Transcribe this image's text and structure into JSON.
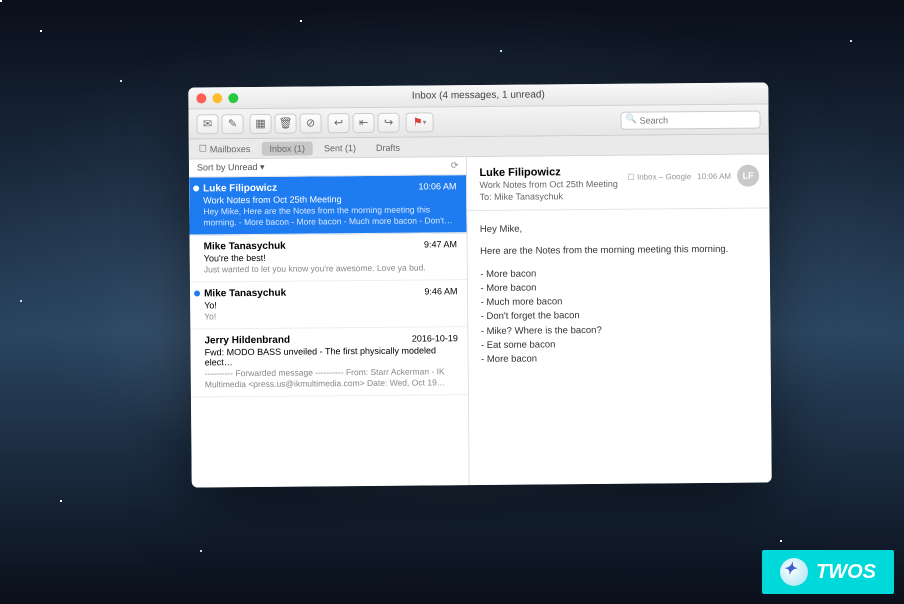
{
  "window": {
    "title": "Inbox (4 messages, 1 unread)"
  },
  "toolbar": {
    "get_mail": "✉",
    "compose": "✎",
    "archive": "▦",
    "trash": "🗑",
    "junk": "⊘",
    "reply": "↩",
    "reply_all": "⇤",
    "forward": "↪",
    "flag": "⚑",
    "search_placeholder": "Search"
  },
  "mailbox_bar": {
    "mailboxes": "Mailboxes",
    "inbox": "Inbox (1)",
    "sent": "Sent (1)",
    "drafts": "Drafts"
  },
  "sort": {
    "label": "Sort by Unread ▾",
    "refresh": "⟳"
  },
  "messages": [
    {
      "from": "Luke Filipowicz",
      "time": "10:06 AM",
      "subject": "Work Notes from Oct 25th Meeting",
      "preview": "Hey Mike,  Here are the Notes from the morning meeting this morning.  - More bacon - More bacon - Much more bacon - Don't…",
      "unread": true,
      "selected": true
    },
    {
      "from": "Mike Tanasychuk",
      "time": "9:47 AM",
      "subject": "You're the best!",
      "preview": "Just wanted to let you know you're awesome. Love ya bud.",
      "unread": false,
      "selected": false
    },
    {
      "from": "Mike Tanasychuk",
      "time": "9:46 AM",
      "subject": "Yo!",
      "preview": "Yo!",
      "unread": true,
      "selected": false
    },
    {
      "from": "Jerry Hildenbrand",
      "time": "2016-10-19",
      "subject": "Fwd: MODO BASS unveiled - The first physically modeled elect…",
      "preview": "---------- Forwarded message ---------- From: Starr Ackerman - IK Multimedia <press.us@ikmultimedia.com> Date: Wed, Oct 19…",
      "unread": false,
      "selected": false
    }
  ],
  "reader": {
    "from": "Luke Filipowicz",
    "subject": "Work Notes from Oct 25th Meeting",
    "to_label": "To:",
    "to": "Mike Tanasychuk",
    "folder": "Inbox – Google",
    "time": "10:06 AM",
    "avatar": "LF",
    "body_greeting": "Hey Mike,",
    "body_intro": "Here are the Notes from the morning meeting this morning.",
    "body_items": [
      "More bacon",
      "More bacon",
      "Much more bacon",
      "Don't forget the bacon",
      "Mike? Where is the bacon?",
      "Eat some bacon",
      "More bacon"
    ]
  },
  "watermark": {
    "text": "TWOS"
  }
}
